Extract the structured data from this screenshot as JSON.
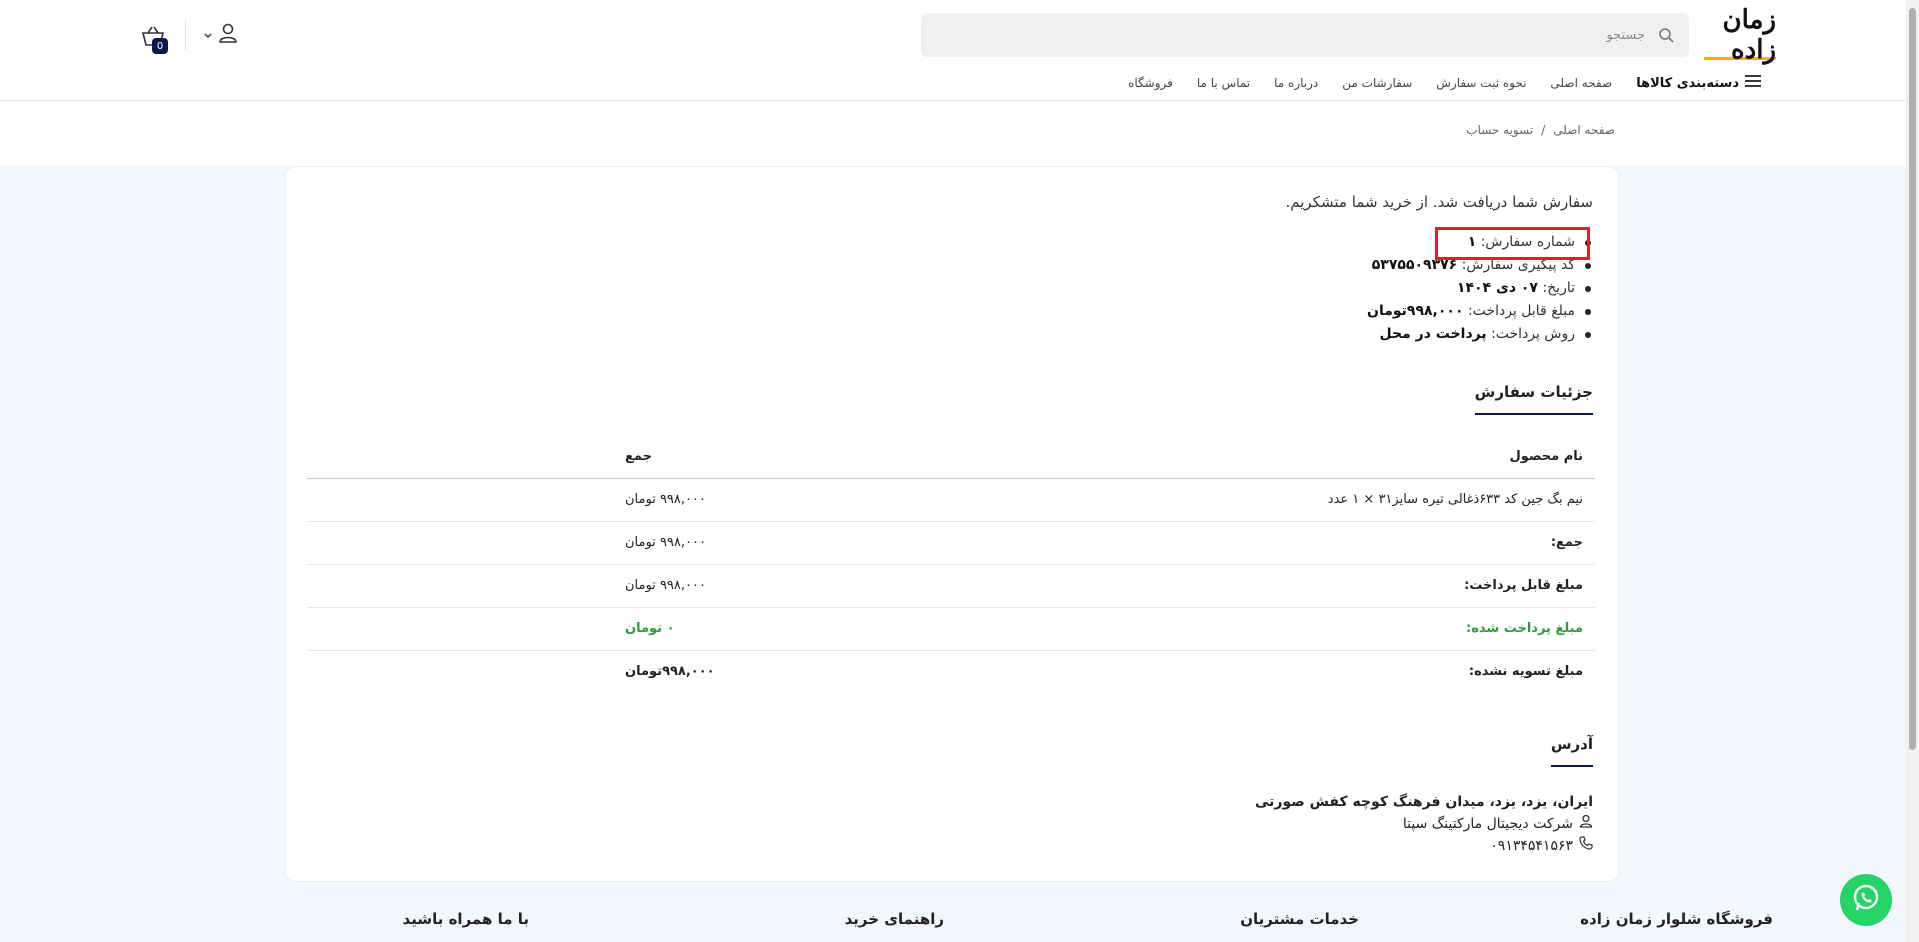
{
  "header": {
    "logo_text": "زمان زاده",
    "search_placeholder": "جستجو",
    "cart_count": "0"
  },
  "nav": {
    "categories_label": "دسته‌بندی کالاها",
    "links": [
      "صفحه اصلی",
      "نحوه ثبت سفارش",
      "سفارشات من",
      "درباره ما",
      "تماس با ما",
      "فروشگاه"
    ]
  },
  "breadcrumb": {
    "home": "صفحه اصلی",
    "separator": "/",
    "current": "تسویه حساب"
  },
  "order": {
    "thanks": "سفارش شما دریافت شد. از خرید شما متشکریم.",
    "summary": [
      {
        "label": "شماره سفارش:",
        "value": "۱"
      },
      {
        "label": "کد پیگیری سفارش:",
        "value": "۵۳۷۵۵۰۹۳۷۶"
      },
      {
        "label": "تاریخ:",
        "value": "۰۷ دی ۱۴۰۴"
      },
      {
        "label": "مبلغ قابل پرداخت:",
        "value": "۹۹۸,۰۰۰تومان"
      },
      {
        "label": "روش پرداخت:",
        "value": "پرداخت در محل"
      }
    ]
  },
  "details": {
    "title": "جزئیات سفارش",
    "col_product": "نام محصول",
    "col_total": "جمع",
    "product_row": {
      "name": "نیم بگ جین کد ۶۳۳ذغالی تیره سایز۳۱ × ۱ عدد",
      "total": "۹۹۸,۰۰۰ تومان"
    },
    "subtotal": {
      "label": "جمع:",
      "value": "۹۹۸,۰۰۰ تومان"
    },
    "payable": {
      "label": "مبلغ قابل پرداخت:",
      "value": "۹۹۸,۰۰۰ تومان"
    },
    "paid": {
      "label": "مبلغ پرداخت شده:",
      "value": "۰ تومان"
    },
    "unsettled": {
      "label": "مبلغ تسویه نشده:",
      "value": "۹۹۸,۰۰۰تومان"
    }
  },
  "address": {
    "title": "آدرس",
    "line": "ایران، یزد، یزد، میدان فرهنگ کوچه کفش صورتی",
    "company": "شرکت دیجیتال مارکتینگ سپتا",
    "phone": "۰۹۱۳۴۵۴۱۵۶۳"
  },
  "footer": {
    "store": "فروشگاه شلوار زمان زاده",
    "services": "خدمات مشتریان",
    "guide": "راهنمای خرید",
    "follow": "با ما همراه باشید"
  },
  "colors": {
    "accent": "#0b1a4a",
    "green": "#2e9b3e",
    "highlight": "#e21e26",
    "whatsapp": "#25d366"
  }
}
